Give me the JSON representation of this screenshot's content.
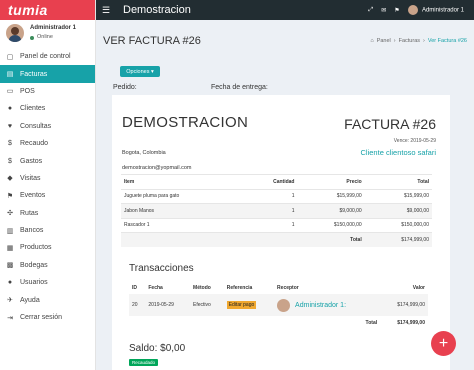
{
  "brand": {
    "logo_text": "tumia"
  },
  "user": {
    "name": "Administrador 1",
    "status": "Online"
  },
  "menu": [
    {
      "label": "Panel de control",
      "icon": "dashboard-icon",
      "glyph": "▢",
      "active": false
    },
    {
      "label": "Facturas",
      "icon": "invoice-icon",
      "glyph": "▤",
      "active": true
    },
    {
      "label": "POS",
      "icon": "pos-icon",
      "glyph": "▭",
      "active": false
    },
    {
      "label": "Clientes",
      "icon": "users-icon",
      "glyph": "●",
      "active": false
    },
    {
      "label": "Consultas",
      "icon": "consultations-icon",
      "glyph": "♥",
      "active": false
    },
    {
      "label": "Recaudo",
      "icon": "dollar-icon",
      "glyph": "$",
      "active": false
    },
    {
      "label": "Gastos",
      "icon": "expenses-icon",
      "glyph": "$",
      "active": false
    },
    {
      "label": "Visitas",
      "icon": "map-marker-icon",
      "glyph": "◆",
      "active": false
    },
    {
      "label": "Eventos",
      "icon": "flag-icon",
      "glyph": "⚑",
      "active": false
    },
    {
      "label": "Rutas",
      "icon": "route-icon",
      "glyph": "✣",
      "active": false
    },
    {
      "label": "Bancos",
      "icon": "bank-icon",
      "glyph": "▥",
      "active": false
    },
    {
      "label": "Productos",
      "icon": "products-icon",
      "glyph": "▦",
      "active": false
    },
    {
      "label": "Bodegas",
      "icon": "warehouse-icon",
      "glyph": "▩",
      "active": false
    },
    {
      "label": "Usuarios",
      "icon": "user-group-icon",
      "glyph": "●",
      "active": false
    },
    {
      "label": "Ayuda",
      "icon": "help-icon",
      "glyph": "✈",
      "active": false
    },
    {
      "label": "Cerrar sesión",
      "icon": "logout-icon",
      "glyph": "⇥",
      "active": false
    }
  ],
  "topbar": {
    "title": "Demostracion",
    "user_name": "Administrador 1"
  },
  "header": {
    "title": "VER FACTURA #26",
    "breadcrumb": [
      "Panel",
      "Facturas",
      "Ver Factura #26"
    ]
  },
  "actions": {
    "options_label": "Opciones ▾"
  },
  "order": {
    "pedido_label": "Pedido:",
    "entrega_label": "Fecha de entrega:"
  },
  "invoice": {
    "company": "DEMOSTRACION",
    "number_title": "FACTURA #26",
    "due": "Vence: 2019-05-29",
    "city": "Bogota, Colombia",
    "client_prefix": "Cliente",
    "client_name": "clientoso safari",
    "email": "demostracion@yopmail.com",
    "columns": [
      "Item",
      "Cantidad",
      "Precio",
      "Total"
    ],
    "items": [
      {
        "item": "Juguete pluma para gato",
        "qty": "1",
        "price": "$15,999,00",
        "total": "$15,999,00"
      },
      {
        "item": "Jabon Manos",
        "qty": "1",
        "price": "$9,000,00",
        "total": "$9,000,00"
      },
      {
        "item": "Rascador 1",
        "qty": "1",
        "price": "$150,000,00",
        "total": "$150,000,00"
      }
    ],
    "total_label": "Total",
    "total_value": "$174,999,00"
  },
  "transactions": {
    "title": "Transacciones",
    "columns": [
      "ID",
      "Fecha",
      "Método",
      "Referencia",
      "Receptor",
      "Valor"
    ],
    "rows": [
      {
        "id": "20",
        "date": "2019-05-29",
        "method": "Efectivo",
        "ref_button": "Editar pago",
        "receiver": "Administrador 1:",
        "value": "$174,999,00"
      }
    ],
    "total_label": "Total",
    "total_value": "$174,999,00"
  },
  "balance": {
    "label": "Saldo: $0,00",
    "badge": "Recaudado"
  },
  "fab": {
    "label": "+"
  },
  "colors": {
    "accent": "#17a2a8",
    "brand": "#e8404f",
    "topbar": "#222d32",
    "success": "#00a65a",
    "warning": "#f0a830"
  }
}
